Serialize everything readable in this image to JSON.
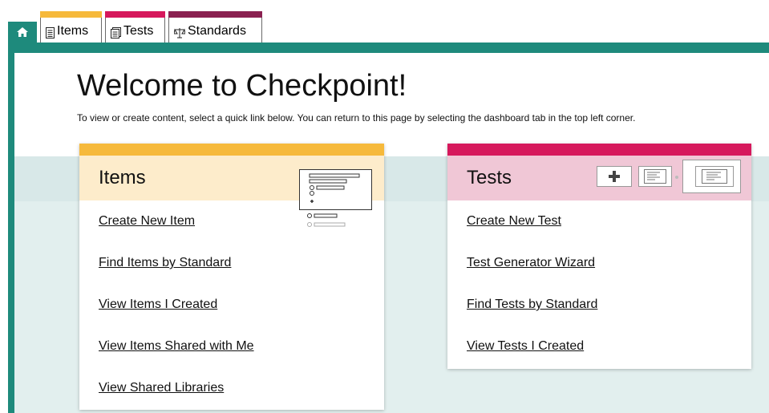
{
  "tabs": {
    "home_icon": "home-icon",
    "items": {
      "label": "Items",
      "icon": "document-icon",
      "color": "#f6b93b"
    },
    "tests": {
      "label": "Tests",
      "icon": "documents-icon",
      "color": "#d6185c"
    },
    "standards": {
      "label": "Standards",
      "icon": "scales-icon",
      "color": "#8a2050"
    }
  },
  "page": {
    "title": "Welcome to Checkpoint!",
    "subtitle": "To view or create content, select a quick link below. You can return to this page by selecting the dashboard tab in the top left corner."
  },
  "colors": {
    "teal": "#1e8a7c",
    "items_accent": "#f6b93b",
    "tests_accent": "#d6185c",
    "band": "#e2efee"
  },
  "items_card": {
    "title": "Items",
    "links": [
      "Create New Item",
      "Find Items by Standard",
      "View Items I Created",
      "View Items Shared with Me",
      "View Shared Libraries"
    ]
  },
  "tests_card": {
    "title": "Tests",
    "links": [
      "Create New Test",
      "Test Generator Wizard",
      "Find Tests by Standard",
      "View Tests I Created"
    ]
  }
}
